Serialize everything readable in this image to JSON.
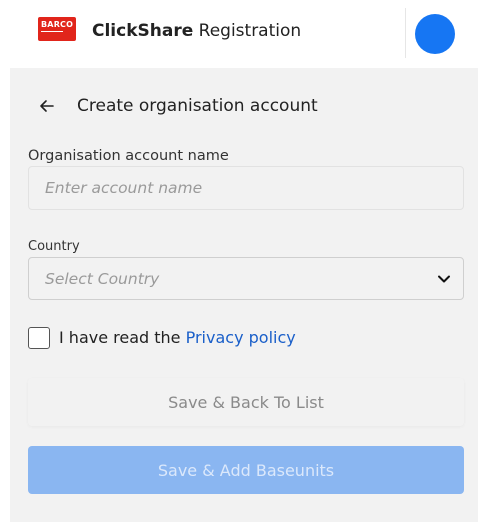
{
  "header": {
    "logo_text": "BARCO",
    "app_name_bold": "ClickShare",
    "app_name_rest": " Registration",
    "avatar_color": "#1676f3",
    "brand_color": "#e1251b"
  },
  "page": {
    "back_icon": "arrow-left-icon",
    "title": "Create organisation account"
  },
  "form": {
    "org_name_label": "Organisation account name",
    "org_name_placeholder": "Enter account name",
    "org_name_value": "",
    "country_label": "Country",
    "country_selected": "Select Country",
    "country_chevron_icon": "chevron-down-icon",
    "privacy_checked": false,
    "privacy_text": "I have read the ",
    "privacy_link": "Privacy policy"
  },
  "buttons": {
    "save_back_label": "Save & Back To List",
    "save_add_label": "Save & Add Baseunits",
    "primary_color": "#8ab6f1"
  }
}
